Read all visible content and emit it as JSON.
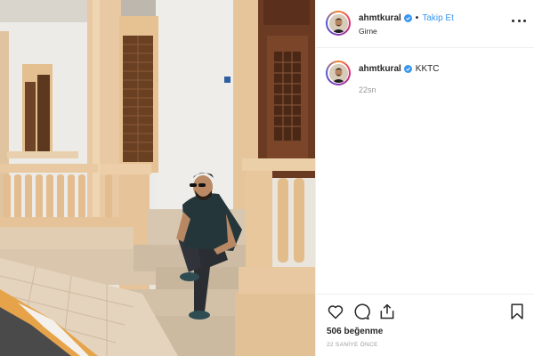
{
  "post": {
    "username": "ahmtkural",
    "verified": true,
    "follow_label": "Takip Et",
    "location": "Girne",
    "caption_text": "KKTC",
    "caption_time": "22sn",
    "likes_label": "506 beğenme",
    "posted_ago": "22 SANİYE ÖNCE"
  },
  "icons": {
    "more": "more-options-icon",
    "like": "heart-icon",
    "comment": "comment-icon",
    "share": "share-icon",
    "save": "bookmark-icon",
    "verified": "verified-badge-icon"
  },
  "colors": {
    "accent": "#3897f0",
    "text": "#262626",
    "muted": "#999999",
    "border": "#efefef"
  }
}
